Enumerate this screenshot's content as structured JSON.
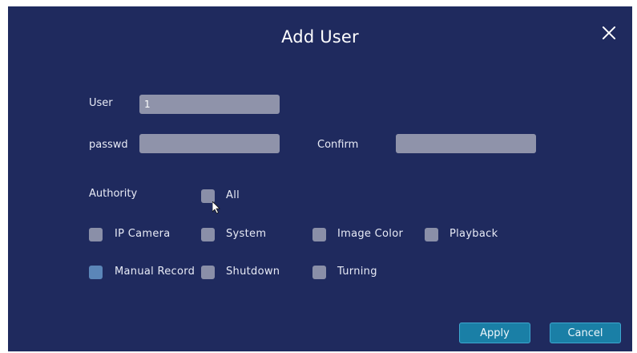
{
  "dialog": {
    "title": "Add User"
  },
  "form": {
    "user_label": "User",
    "user_value": "1",
    "passwd_label": "passwd",
    "passwd_value": "",
    "confirm_label": "Confirm",
    "confirm_value": ""
  },
  "authority": {
    "label": "Authority",
    "all_label": "All",
    "permissions": [
      {
        "label": "IP Camera",
        "checked": false
      },
      {
        "label": "System",
        "checked": false
      },
      {
        "label": "Image Color",
        "checked": false
      },
      {
        "label": "Playback",
        "checked": false
      },
      {
        "label": "Manual Record",
        "checked": true
      },
      {
        "label": "Shutdown",
        "checked": false
      },
      {
        "label": "Turning",
        "checked": false
      }
    ]
  },
  "buttons": {
    "apply": "Apply",
    "cancel": "Cancel"
  },
  "colors": {
    "background": "#1f2a5e",
    "field": "#8f93aa",
    "button": "#1a7fa6"
  }
}
